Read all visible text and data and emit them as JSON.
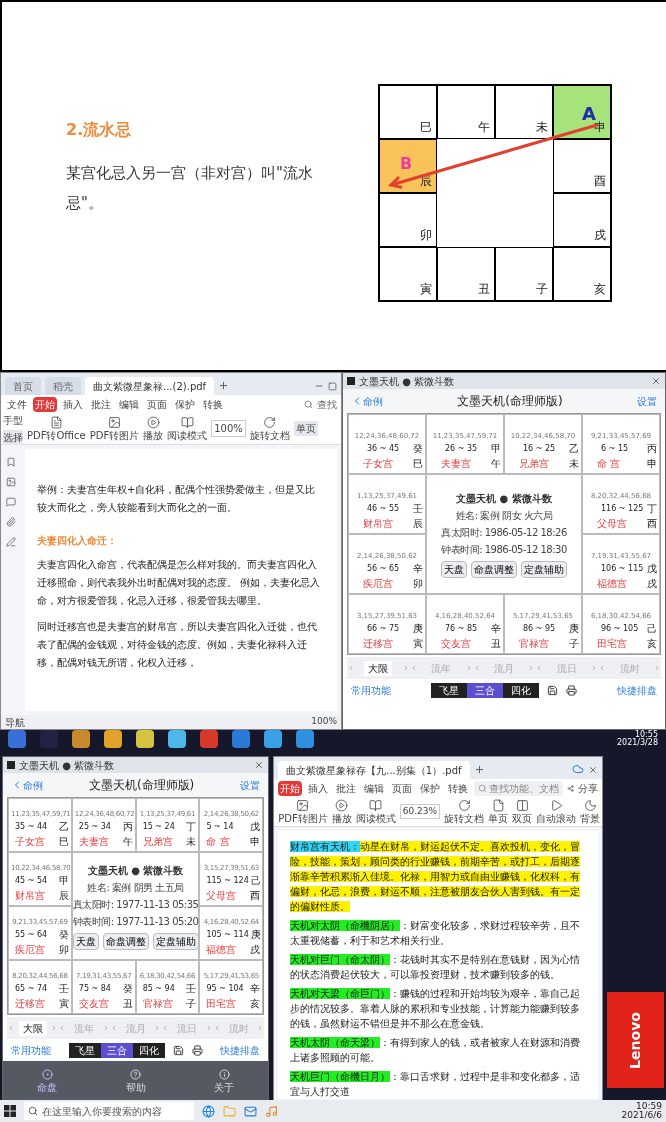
{
  "slide": {
    "heading": "2.流水忌",
    "body": "某宫化忌入另一宫（非对宫）叫\"流水忌\"。",
    "palaces": [
      {
        "branch": "巳",
        "kind": "plain"
      },
      {
        "branch": "午",
        "kind": "plain"
      },
      {
        "branch": "未",
        "kind": "plain"
      },
      {
        "branch": "申",
        "kind": "source",
        "label": "A"
      },
      {
        "branch": "辰",
        "kind": "target",
        "label": "B"
      },
      {
        "branch": "酉",
        "kind": "plain"
      },
      {
        "branch": "卯",
        "kind": "plain"
      },
      {
        "branch": "戌",
        "kind": "plain"
      },
      {
        "branch": "寅",
        "kind": "plain"
      },
      {
        "branch": "丑",
        "kind": "plain"
      },
      {
        "branch": "子",
        "kind": "plain"
      },
      {
        "branch": "亥",
        "kind": "plain"
      }
    ]
  },
  "top_screen": {
    "pdf_window": {
      "tabs": [
        {
          "label": "首页",
          "selected": false
        },
        {
          "label": "稻壳",
          "selected": false
        },
        {
          "label": "曲文紫微星象禄...(2).pdf",
          "selected": true
        }
      ],
      "menu": [
        {
          "label": "文件",
          "selected": false
        },
        {
          "label": "开始",
          "selected": true
        },
        {
          "label": "插入",
          "selected": false
        },
        {
          "label": "批注",
          "selected": false
        },
        {
          "label": "编辑",
          "selected": false
        },
        {
          "label": "页面",
          "selected": false
        },
        {
          "label": "保护",
          "selected": false
        },
        {
          "label": "转换",
          "selected": false
        }
      ],
      "search": "查找",
      "tools": [
        "PDF转Office",
        "PDF转图片",
        "播放",
        "阅读模式"
      ],
      "hand": "手型",
      "select": "选择",
      "zoom": "100%",
      "rotate": "旋转文档",
      "single_page": "单页",
      "paragraphs": [
        {
          "kind": "text",
          "text": "举例：夫妻宫生年权+自化科，配偶个性强势爱做主，但是又比较大而化之，旁人较能看到大而化之的一面。"
        },
        {
          "kind": "heading",
          "text": "夫妻四化入命迁："
        },
        {
          "kind": "text",
          "text": "夫妻宫四化入命宫，代表配偶是怎么样对我的。而夫妻宫四化入迁移照命，则代表我外出时配偶对我的态度。 例如，夫妻化忌入命，对方很爱管我，化忌入迁移，很爱管我去哪里。"
        },
        {
          "kind": "text",
          "text": "同时迁移宫也是夫妻宫的财帛宫，所以夫妻宫四化入迁徙，也代表了配偶的金钱观，对待金钱的态度。例如，夫妻化禄科入迁移，配偶对钱无所谓，化权入迁移，"
        }
      ],
      "status_nav": "导航",
      "status_zoom": "100%"
    },
    "chart_window": {
      "title_bar": "文墨天机 ● 紫微斗数",
      "back": "命例",
      "title": "文墨天机(命理师版)",
      "settings": "设置",
      "palaces": [
        {
          "ages": "12,24,36,48,60,72",
          "range": "36 ~ 45",
          "stem": "癸",
          "branch": "巳",
          "palace": "子女宫"
        },
        {
          "ages": "11,23,35,47,59,71",
          "range": "26 ~ 35",
          "stem": "甲",
          "branch": "午",
          "palace": "夫妻宫"
        },
        {
          "ages": "10,22,34,46,58,70",
          "range": "16 ~ 25",
          "stem": "乙",
          "branch": "未",
          "palace": "兄弟宫"
        },
        {
          "ages": "9,21,33,45,57,69",
          "range": "6 ~ 15",
          "stem": "丙",
          "branch": "申",
          "palace": "命 宫"
        },
        {
          "ages": "1,13,25,37,49,61",
          "range": "46 ~ 55",
          "stem": "壬",
          "branch": "辰",
          "palace": "财帛宫"
        },
        {
          "ages": "8,20,32,44,56,68",
          "range": "116 ~ 125",
          "stem": "丁",
          "branch": "酉",
          "palace": "父母宫"
        },
        {
          "ages": "2,14,26,38,50,62",
          "range": "56 ~ 65",
          "stem": "辛",
          "branch": "卯",
          "palace": "疾厄宫"
        },
        {
          "ages": "7,19,31,43,55,67",
          "range": "106 ~ 115",
          "stem": "戊",
          "branch": "戌",
          "palace": "福德宫"
        },
        {
          "ages": "3,15,27,39,51,63",
          "range": "66 ~ 75",
          "stem": "庚",
          "branch": "寅",
          "palace": "迁移宫"
        },
        {
          "ages": "4,16,28,40,52,64",
          "range": "76 ~ 85",
          "stem": "辛",
          "branch": "丑",
          "palace": "交友宫"
        },
        {
          "ages": "5,17,29,41,53,65",
          "range": "86 ~ 95",
          "stem": "庚",
          "branch": "子",
          "palace": "官禄宫"
        },
        {
          "ages": "6,18,30,42,54,66",
          "range": "96 ~ 105",
          "stem": "己",
          "branch": "亥",
          "palace": "田宅宫"
        }
      ],
      "center": {
        "title": "文墨天机 ● 紫微斗数",
        "lines": [
          "姓名: 案例  阴女 火六局",
          "真太阳时: 1986-05-12 18:26",
          "钟表时间: 1986-05-12 18:30"
        ],
        "buttons": [
          "天盘",
          "命盘调整",
          "定盘辅助"
        ]
      },
      "periods": [
        {
          "label": "大限",
          "selected": true
        },
        {
          "label": "流年",
          "selected": false
        },
        {
          "label": "流月",
          "selected": false
        },
        {
          "label": "流日",
          "selected": false
        },
        {
          "label": "流时",
          "selected": false
        }
      ],
      "common_functions": "常用功能",
      "modes": [
        {
          "label": "飞星",
          "selected": false
        },
        {
          "label": "三合",
          "selected": true
        },
        {
          "label": "四化",
          "selected": false
        }
      ],
      "quick_chart": "快捷排盘"
    }
  },
  "bottom_screen": {
    "tray": {
      "time": "10:55",
      "date": "2021/3/28"
    },
    "chart_window": {
      "title_bar": "文墨天机 ● 紫微斗数",
      "back": "命例",
      "title": "文墨天机(命理师版)",
      "settings": "设置",
      "palaces": [
        {
          "ages": "11,23,35,47,59,71",
          "range": "35 ~ 44",
          "stem": "乙",
          "branch": "巳",
          "palace": "子女宫"
        },
        {
          "ages": "12,24,36,48,60,72",
          "range": "25 ~ 34",
          "stem": "丙",
          "branch": "午",
          "palace": "夫妻宫"
        },
        {
          "ages": "1,13,25,37,49,61",
          "range": "15 ~ 24",
          "stem": "丁",
          "branch": "未",
          "palace": "兄弟宫"
        },
        {
          "ages": "2,14,26,38,50,62",
          "range": "5 ~ 14",
          "stem": "戊",
          "branch": "申",
          "palace": "命 宫"
        },
        {
          "ages": "10,22,34,46,58,70",
          "range": "45 ~ 54",
          "stem": "甲",
          "branch": "辰",
          "palace": "财帛宫"
        },
        {
          "ages": "3,15,27,39,51,63",
          "range": "115 ~ 124",
          "stem": "己",
          "branch": "酉",
          "palace": "父母宫"
        },
        {
          "ages": "9,21,33,45,57,69",
          "range": "55 ~ 64",
          "stem": "癸",
          "branch": "卯",
          "palace": "疾厄宫"
        },
        {
          "ages": "4,16,28,40,52,64",
          "range": "105 ~ 114",
          "stem": "庚",
          "branch": "戌",
          "palace": "福德宫"
        },
        {
          "ages": "8,20,32,44,56,68",
          "range": "65 ~ 74",
          "stem": "壬",
          "branch": "寅",
          "palace": "迁移宫"
        },
        {
          "ages": "7,19,31,43,55,67",
          "range": "75 ~ 84",
          "stem": "癸",
          "branch": "丑",
          "palace": "交友宫"
        },
        {
          "ages": "6,18,30,42,54,66",
          "range": "85 ~ 94",
          "stem": "壬",
          "branch": "子",
          "palace": "官禄宫"
        },
        {
          "ages": "5,17,29,41,53,65",
          "range": "95 ~ 104",
          "stem": "辛",
          "branch": "亥",
          "palace": "田宅宫"
        }
      ],
      "center": {
        "title": "文墨天机 ● 紫微斗数",
        "lines": [
          "姓名: 案例  阴男 土五局",
          "真太阳时: 1977-11-13 05:35",
          "钟表时间: 1977-11-13 05:20"
        ],
        "buttons": [
          "天盘",
          "命盘调整",
          "定盘辅助"
        ]
      },
      "periods": [
        {
          "label": "大限",
          "selected": true
        },
        {
          "label": "流年",
          "selected": false
        },
        {
          "label": "流月",
          "selected": false
        },
        {
          "label": "流日",
          "selected": false
        },
        {
          "label": "流时",
          "selected": false
        }
      ],
      "common_functions": "常用功能",
      "modes": [
        {
          "label": "飞星",
          "selected": false
        },
        {
          "label": "三合",
          "selected": true
        },
        {
          "label": "四化",
          "selected": false
        }
      ],
      "quick_chart": "快捷排盘",
      "bottom_nav": [
        {
          "label": "命盘",
          "selected": true
        },
        {
          "label": "帮助",
          "selected": false
        },
        {
          "label": "关于",
          "selected": false
        }
      ]
    },
    "pdf_window": {
      "tabs": [
        {
          "label": "曲文紫微星象禄存【九...别集（1）.pdf",
          "selected": true
        }
      ],
      "menu": [
        {
          "label": "开始",
          "selected": true
        },
        {
          "label": "插入",
          "selected": false
        },
        {
          "label": "批注",
          "selected": false
        },
        {
          "label": "编辑",
          "selected": false
        },
        {
          "label": "页面",
          "selected": false
        },
        {
          "label": "保护",
          "selected": false
        },
        {
          "label": "转换",
          "selected": false
        }
      ],
      "search": "查找功能、文档",
      "share": "分享",
      "tools": [
        "PDF转图片",
        "播放",
        "阅读模式"
      ],
      "zoom": "60.23%",
      "rotate": "旋转文档",
      "views": [
        "单页",
        "双页",
        "自动滚动",
        "背景"
      ],
      "paragraphs": [
        {
          "kind": "intro",
          "label": "财帛宫有天机：",
          "text": "动星在财帛，财运起伏不定。喜欢投机，变化，冒险，技能，策划，顾问类的行业赚钱，前期辛苦，或打工，后期逐渐靠辛苦积累渐入佳境。化禄，用智力或自由业赚钱，化权科，有偏财，化忌，浪费，财运不顺，注意被朋友合伙人害到钱。有一定的偏财性质。"
        },
        {
          "kind": "pair",
          "label": "天机对太阴（命機阴居）",
          "text": "：财富变化较多，求财过程较辛劳，且不太重视储蓄，利于和艺术相关行业。"
        },
        {
          "kind": "pair",
          "label": "天机对巨门（命太阴）",
          "text": "：花钱时其实不是特别在意钱财，因为心情的状态消费起伏较大，可以靠投资理财，技术赚到较多的钱。"
        },
        {
          "kind": "pair",
          "label": "天机对天梁（命巨门）",
          "text": "：赚钱的过程和开始均较为艰辛，靠自己起步的情况较多。靠着人脉的累积和专业技能，计算能力能赚到较多的钱，虽然财运不错但是并不那么在意金钱。"
        },
        {
          "kind": "pair",
          "label": "天机太阴（命天梁）",
          "text": "：有得到家人的钱，或者被家人在财源和消费上诸多照顾的可能。"
        },
        {
          "kind": "pair",
          "label": "天机巨门（命機日月）",
          "text": "：靠口舌求财，过程中是非和变化都多，适宜与人打交道"
        }
      ]
    },
    "brand": "Lenovo"
  },
  "taskbar": {
    "search_placeholder": "在这里输入你要搜索的内容",
    "time": "10:59",
    "date": "2021/6/6"
  }
}
